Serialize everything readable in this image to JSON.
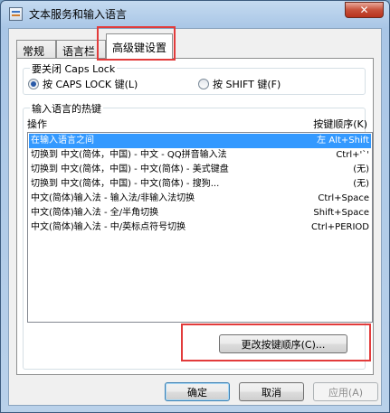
{
  "window": {
    "title": "文本服务和输入语言",
    "close_glyph": "✕"
  },
  "tabs": [
    {
      "label": "常规"
    },
    {
      "label": "语言栏"
    },
    {
      "label": "高级键设置"
    }
  ],
  "caps_group": {
    "title": "要关闭 Caps Lock",
    "option1": "按 CAPS LOCK 键(L)",
    "option2": "按 SHIFT 键(F)",
    "selected": "option1"
  },
  "hotkeys_group": {
    "title": "输入语言的热键",
    "col_action": "操作",
    "col_sequence": "按键顺序(K)",
    "rows": [
      {
        "action": "在输入语言之间",
        "keys": "左 Alt+Shift"
      },
      {
        "action": "切换到 中文(简体，中国) - 中文 - QQ拼音输入法",
        "keys": "Ctrl+'`'"
      },
      {
        "action": "切换到 中文(简体，中国) - 中文(简体) - 美式键盘",
        "keys": "(无)"
      },
      {
        "action": "切换到 中文(简体，中国) - 中文(简体) - 搜狗...",
        "keys": "(无)"
      },
      {
        "action": "中文(简体)输入法 - 输入法/非输入法切换",
        "keys": "Ctrl+Space"
      },
      {
        "action": "中文(简体)输入法 - 全/半角切换",
        "keys": "Shift+Space"
      },
      {
        "action": "中文(简体)输入法 - 中/英标点符号切换",
        "keys": "Ctrl+PERIOD"
      }
    ],
    "change_button": "更改按键顺序(C)..."
  },
  "footer": {
    "ok": "确定",
    "cancel": "取消",
    "apply": "应用(A)"
  },
  "colors": {
    "selection": "#3399ff",
    "highlight_box": "#e23b3b"
  },
  "icons": {
    "title_icon": "keyboard-language-icon",
    "close": "close-icon"
  }
}
